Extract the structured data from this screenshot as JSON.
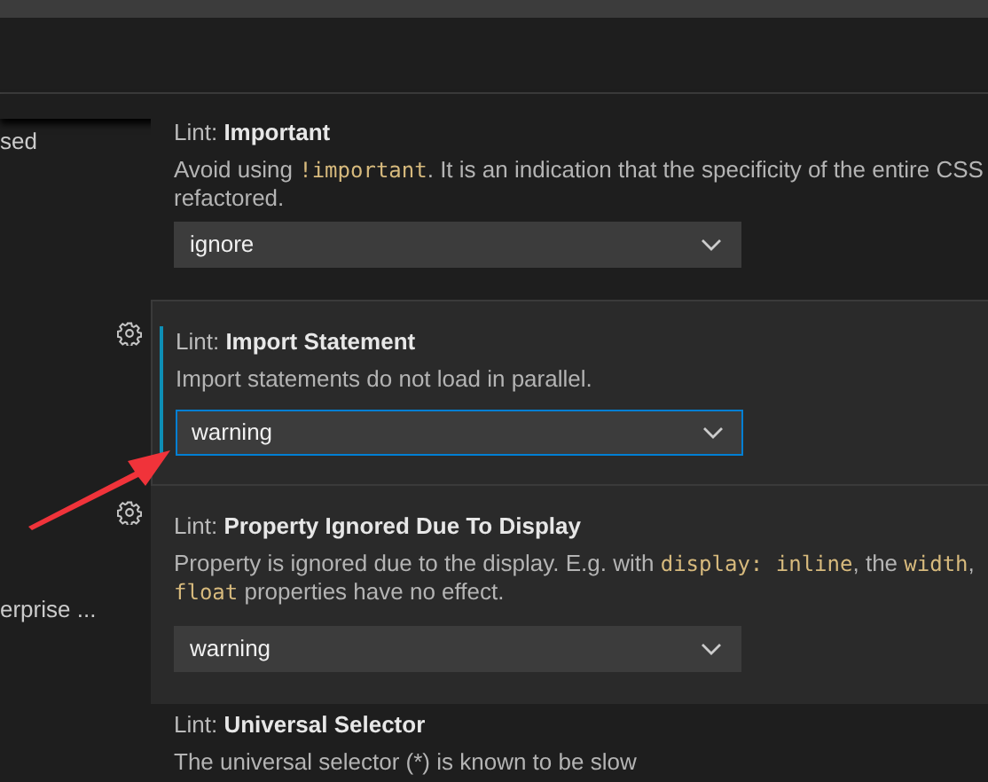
{
  "sidebar": {
    "items": [
      {
        "label": "sed"
      },
      {
        "label": "erprise ..."
      }
    ]
  },
  "settings": [
    {
      "prefix": "Lint: ",
      "title": "Important",
      "gear": false,
      "focused": false,
      "hovered": false,
      "description": [
        [
          {
            "text": "Avoid using "
          },
          {
            "text": "!important",
            "code": true
          },
          {
            "text": ". It is an indication that the specificity of the entire CSS"
          }
        ],
        [
          {
            "text": "refactored."
          }
        ]
      ],
      "value": "ignore"
    },
    {
      "prefix": "Lint: ",
      "title": "Import Statement",
      "gear": true,
      "focused": true,
      "hovered": true,
      "description": [
        [
          {
            "text": "Import statements do not load in parallel."
          }
        ]
      ],
      "value": "warning"
    },
    {
      "prefix": "Lint: ",
      "title": "Property Ignored Due To Display",
      "gear": true,
      "focused": false,
      "hovered": true,
      "description": [
        [
          {
            "text": "Property is ignored due to the display. E.g. with "
          },
          {
            "text": "display: inline",
            "code": true
          },
          {
            "text": ", the "
          },
          {
            "text": "width",
            "code": true
          },
          {
            "text": ", "
          }
        ],
        [
          {
            "text": "float",
            "code": true
          },
          {
            "text": " properties have no effect."
          }
        ]
      ],
      "value": "warning"
    },
    {
      "prefix": "Lint: ",
      "title": "Universal Selector",
      "gear": false,
      "focused": false,
      "hovered": false,
      "description": [
        [
          {
            "text": "The universal selector (*) is known to be slow"
          }
        ]
      ]
    }
  ]
}
